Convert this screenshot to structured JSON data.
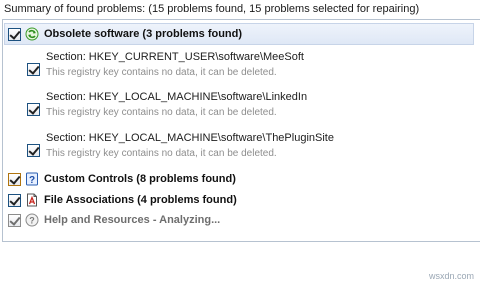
{
  "summary": "Summary of found problems: (15 problems found, 15 problems selected for repairing)",
  "groups": [
    {
      "title": "Obsolete software (3 problems found)",
      "icon": "recycle-icon",
      "items": [
        {
          "section": "Section: HKEY_CURRENT_USER\\software\\MeeSoft",
          "description": "This registry key contains no data, it can be deleted."
        },
        {
          "section": "Section: HKEY_LOCAL_MACHINE\\software\\LinkedIn",
          "description": "This registry key contains no data, it can be deleted."
        },
        {
          "section": "Section: HKEY_LOCAL_MACHINE\\software\\ThePluginSite",
          "description": "This registry key contains no data, it can be deleted."
        }
      ]
    },
    {
      "title": "Custom Controls (8 problems found)",
      "icon": "help-book-icon"
    },
    {
      "title": "File Associations (4 problems found)",
      "icon": "file-icon"
    },
    {
      "title": "Help and Resources - Analyzing...",
      "icon": "help-circle-icon"
    }
  ],
  "watermark": "wsxdn.com",
  "colors": {
    "check_green": "#21a121",
    "group_highlight": "#dfe8f6",
    "border_blue": "#b6c2d0"
  }
}
